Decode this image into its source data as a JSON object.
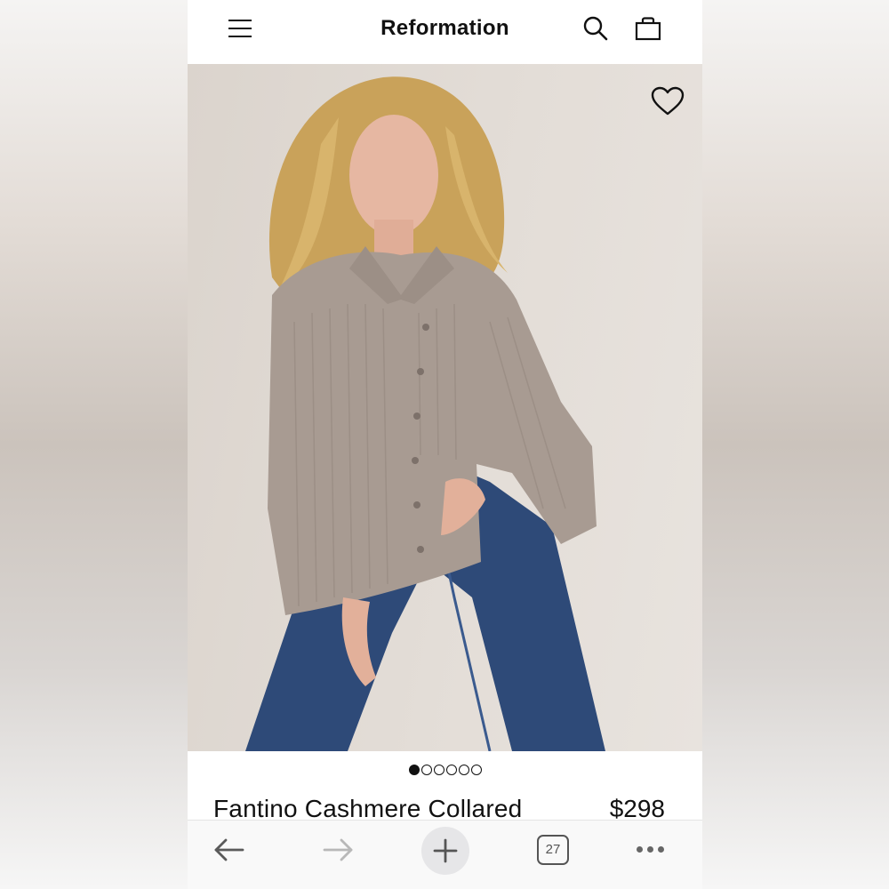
{
  "header": {
    "brand": "Reformation",
    "icons": [
      "menu-icon",
      "search-icon",
      "bag-icon"
    ]
  },
  "hero": {
    "favorite_icon": "heart-outline-icon",
    "carousel": {
      "total": 6,
      "active_index": 0
    }
  },
  "product": {
    "name": "Fantino Cashmere Collared",
    "price": "$298"
  },
  "browser_toolbar": {
    "tab_count": "27",
    "icons": [
      "back-arrow-icon",
      "forward-arrow-icon",
      "new-tab-plus-icon",
      "tabs-icon",
      "more-dots-icon"
    ]
  },
  "colors": {
    "text": "#111111",
    "hero_bg": "#e3ddd7",
    "sweater": "#a89b92",
    "jeans": "#2e4a78",
    "toolbar_bg": "#f9f9f9",
    "disabled_icon": "#b8b8b8"
  }
}
